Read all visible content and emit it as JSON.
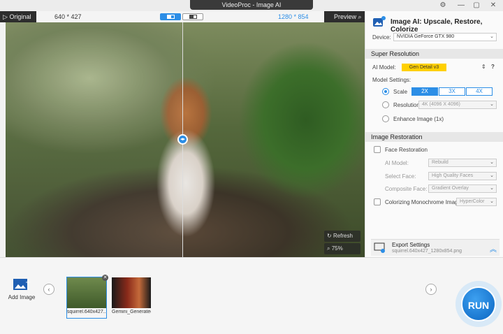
{
  "window": {
    "title": "VideoProc - Image AI"
  },
  "preview": {
    "original_label": "Original",
    "original_resolution": "640 * 427",
    "output_resolution": "1280 * 854",
    "preview_label": "Preview",
    "refresh_label": "Refresh",
    "zoom": "75%"
  },
  "panel": {
    "title": "Image AI: Upscale, Restore, Colorize",
    "device_label": "Device:",
    "device_value": "NVIDIA GeForce GTX 980",
    "super_resolution": {
      "heading": "Super Resolution",
      "ai_model_label": "AI Model:",
      "ai_model_value": "Gen Detail v3",
      "help": "?",
      "model_settings_label": "Model Settings:",
      "scale_label": "Scale",
      "scale_options": [
        "2X",
        "3X",
        "4X"
      ],
      "scale_selected": "2X",
      "resolution_label": "Resolution",
      "resolution_value": "4K (4096 X 4096)",
      "enhance_label": "Enhance Image (1x)"
    },
    "image_restoration": {
      "heading": "Image Restoration",
      "face_restoration_label": "Face Restoration",
      "ai_model_label": "AI Model:",
      "ai_model_value": "Rebuild",
      "select_face_label": "Select Face:",
      "select_face_value": "High Quality Faces",
      "composite_face_label": "Composite Face:",
      "composite_face_value": "Gradient Overlay",
      "colorize_label": "Colorizing Monochrome Image:",
      "colorize_value": "HyperColor"
    },
    "export": {
      "label": "Export Settings",
      "filename": "squirrel.640x427_1280x854.png"
    }
  },
  "bottom": {
    "add_image_label": "Add Image",
    "thumbnails": [
      {
        "caption": "squirrel.640x427...",
        "selected": true
      },
      {
        "caption": "Gemini_Generated...",
        "selected": false
      }
    ],
    "run_label": "RUN"
  },
  "colors": {
    "accent": "#2c8ee6",
    "model_badge": "#ffd000"
  }
}
